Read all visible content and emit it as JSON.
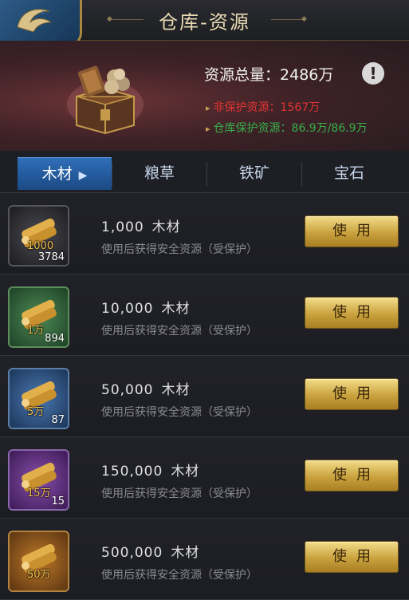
{
  "header": {
    "title": "仓库-资源",
    "logo_icon": "dragon-emblem-icon"
  },
  "summary": {
    "total_label": "资源总量：",
    "total_value": "2486万",
    "info_icon": "exclamation-icon",
    "unprotected_label": "非保护资源：",
    "unprotected_value": "1567万",
    "protected_label": "仓库保护资源：",
    "protected_value": "86.9万/86.9万",
    "colors": {
      "unprotected": "#e33333",
      "protected": "#36b04a"
    }
  },
  "tabs": [
    {
      "label": "木材",
      "active": true
    },
    {
      "label": "粮草",
      "active": false
    },
    {
      "label": "铁矿",
      "active": false
    },
    {
      "label": "宝石",
      "active": false
    }
  ],
  "items": [
    {
      "name": "1,000",
      "unit": "木材",
      "desc": "使用后获得安全资源（受保护）",
      "icon_amount": "1000",
      "count": "3784",
      "rarity": "gray",
      "button": "使用"
    },
    {
      "name": "10,000",
      "unit": "木材",
      "desc": "使用后获得安全资源（受保护）",
      "icon_amount": "1万",
      "count": "894",
      "rarity": "green",
      "button": "使用"
    },
    {
      "name": "50,000",
      "unit": "木材",
      "desc": "使用后获得安全资源（受保护）",
      "icon_amount": "5万",
      "count": "87",
      "rarity": "blue",
      "button": "使用"
    },
    {
      "name": "150,000",
      "unit": "木材",
      "desc": "使用后获得安全资源（受保护）",
      "icon_amount": "15万",
      "count": "15",
      "rarity": "purple",
      "button": "使用"
    },
    {
      "name": "500,000",
      "unit": "木材",
      "desc": "使用后获得安全资源（受保护）",
      "icon_amount": "50万",
      "count": "",
      "rarity": "orange",
      "button": "使用"
    }
  ]
}
